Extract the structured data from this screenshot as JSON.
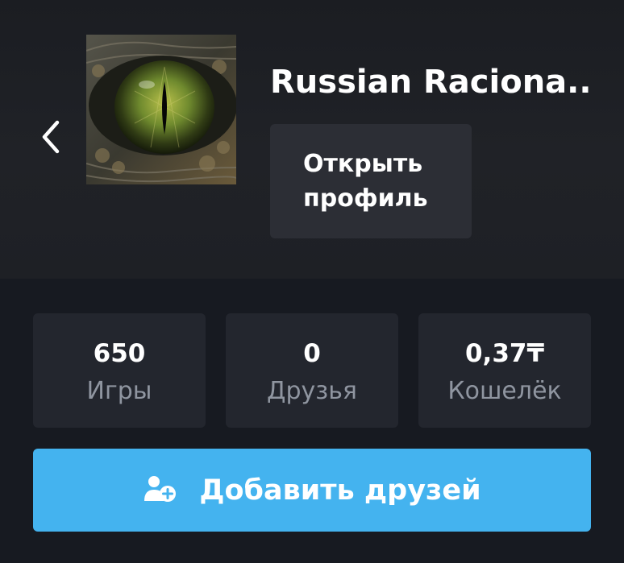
{
  "profile": {
    "username": "Russian Raciona..",
    "avatar_icon": "reptile-eye-avatar",
    "back_icon": "chevron-left-icon",
    "open_profile_label": "Открыть\nпрофиль"
  },
  "stats": [
    {
      "value": "650",
      "label": "Игры"
    },
    {
      "value": "0",
      "label": "Друзья"
    },
    {
      "value": "0,37₸",
      "label": "Кошелёк"
    }
  ],
  "add_friends": {
    "label": "Добавить друзей",
    "icon": "add-user-icon"
  },
  "colors": {
    "background": "#171a21",
    "header": "#202227",
    "card": "#23262e",
    "button_secondary": "#2c2e35",
    "accent": "#44b3ef",
    "muted_text": "#8f95a0"
  }
}
